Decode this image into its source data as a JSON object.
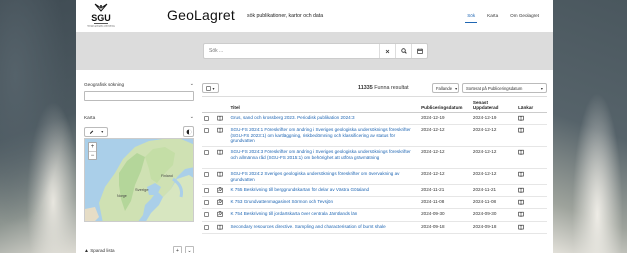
{
  "header": {
    "brand": "GeoLagret",
    "tagline": "sök publikationer, kartor och data",
    "nav": [
      {
        "label": "Sök",
        "active": true
      },
      {
        "label": "Karta",
        "active": false
      },
      {
        "label": "Om Geolagret",
        "active": false
      }
    ],
    "logo_text": "SGU",
    "logo_subtext": "Sveriges geologiska undersökning"
  },
  "search": {
    "placeholder": "Sök ...",
    "clear_icon": "close-icon",
    "search_icon": "search-icon",
    "calendar_icon": "calendar-icon"
  },
  "filters": {
    "geo_label": "Geografisk sökning",
    "map_label": "Karta",
    "saved_label": "Sparad lista",
    "map_labels": [
      "Sverige",
      "Finland",
      "Norge"
    ]
  },
  "results": {
    "count": "11335",
    "count_suffix": "Funna resultat",
    "order": "Fallande",
    "sort": "Sorterat på Publiceringsdatum",
    "columns": {
      "title": "Titel",
      "published": "Publiceringsdatum",
      "updated": "Senast Uppdaterad",
      "links": "Länkar"
    },
    "rows": [
      {
        "type": "book",
        "title": "Grus, sand och krossberg 2023. Periodisk publikation 2024:3",
        "published": "2024-12-19",
        "updated": "2024-12-19"
      },
      {
        "type": "book",
        "title": "SGU-FS 2024:1 Föreskrifter om ändring i Sveriges geologiska undersöknings föreskrifter (SGU-FS 2023:1) om kartläggning, riskbedömning och klassificering av status för grundvatten",
        "published": "2024-12-12",
        "updated": "2024-12-12"
      },
      {
        "type": "book",
        "title": "SGU-FS 2024:3 Föreskrifter om ändring i Sveriges geologiska undersöknings föreskrifter och allmänna råd (SGU-FS 2015:1) om behörighet att utföra grävmätning",
        "published": "2024-12-12",
        "updated": "2024-12-12"
      },
      {
        "type": "book",
        "title": "SGU-FS 2024:2 Sveriges geologiska undersöknings föreskrifter om övervakning av grundvatten",
        "published": "2024-12-12",
        "updated": "2024-12-12"
      },
      {
        "type": "map",
        "title": "K 755 Beskrivning till berggrundskartan för delar av Västra Götaland",
        "published": "2024-11-21",
        "updated": "2024-11-21"
      },
      {
        "type": "map",
        "title": "K 753 Grundvattenmagasinet Sörmon och Tevsjön",
        "published": "2024-11-08",
        "updated": "2024-11-08"
      },
      {
        "type": "map",
        "title": "K 754 Beskrivning till jordartskarta över centrala Jämtlands län",
        "published": "2024-09-30",
        "updated": "2024-09-30"
      },
      {
        "type": "book",
        "title": "Secondary resources directive. Sampling and characterisation of burnt shale",
        "published": "2024-09-18",
        "updated": "2024-09-18"
      }
    ]
  },
  "colors": {
    "link": "#1f66b3",
    "search_band": "#dcdcdc"
  }
}
